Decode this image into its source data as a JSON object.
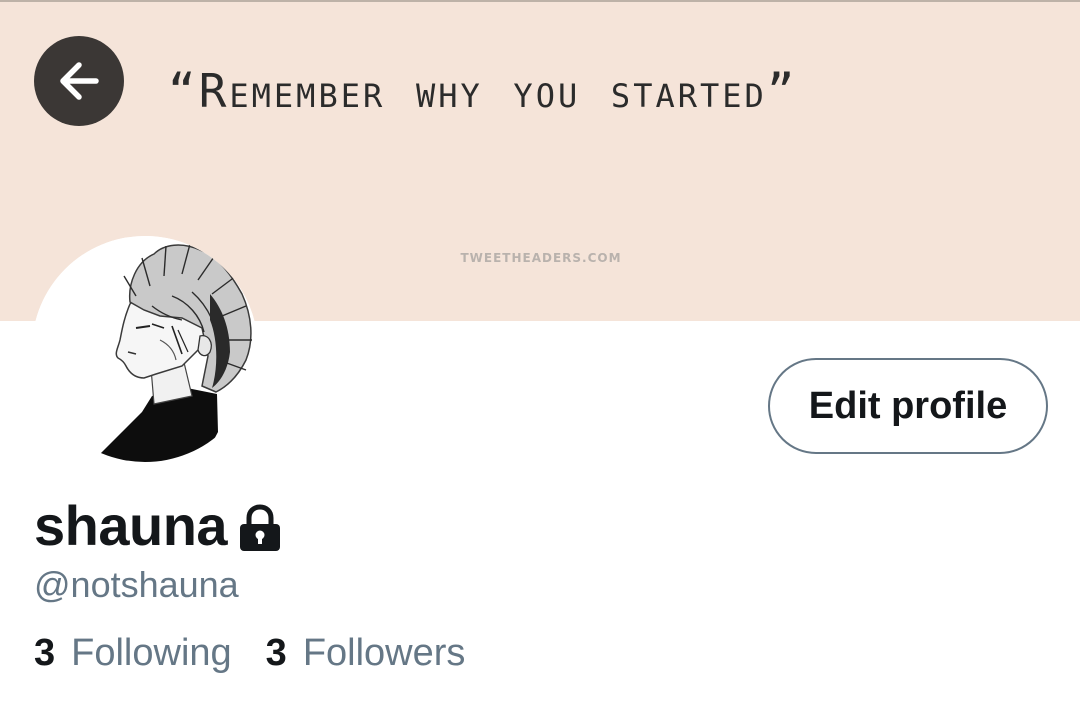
{
  "banner": {
    "quote": "“Remember why you started”",
    "credit": "TWEETHEADERS.COM",
    "background_color": "#f5e4d9"
  },
  "back_button": {
    "icon": "arrow-left-icon"
  },
  "profile": {
    "display_name": "shauna",
    "protected_icon": "lock-icon",
    "handle": "@notshauna",
    "edit_button_label": "Edit profile"
  },
  "stats": {
    "following_count": "3",
    "following_label": "Following",
    "followers_count": "3",
    "followers_label": "Followers"
  },
  "colors": {
    "primary_text": "#14171a",
    "secondary_text": "#657786",
    "button_border": "#657786",
    "back_button_bg": "#3b3735"
  }
}
